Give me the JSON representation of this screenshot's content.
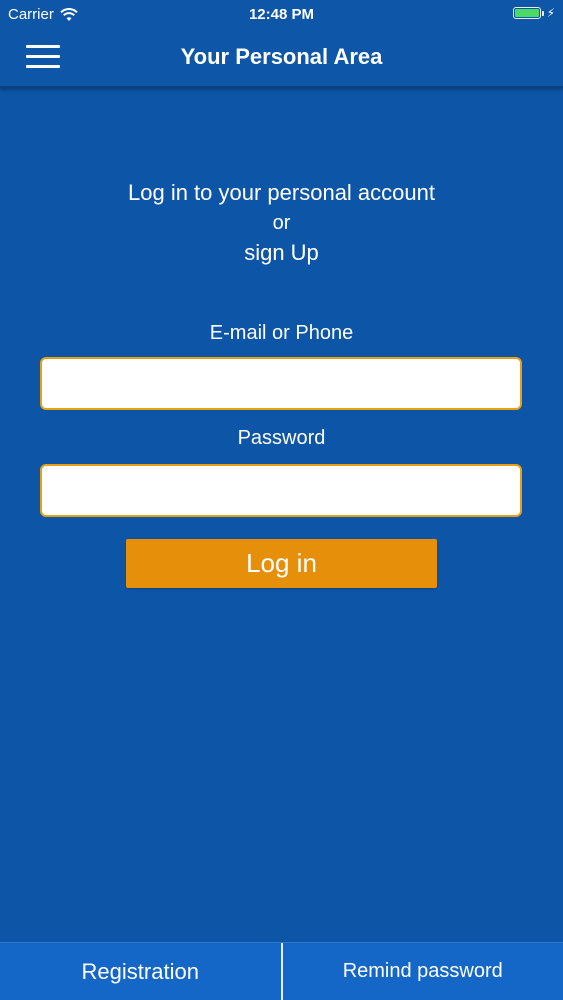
{
  "status_bar": {
    "carrier": "Carrier",
    "time": "12:48 PM",
    "battery_level": 1.0,
    "icons": [
      "wifi-icon",
      "battery-icon",
      "charging-bolt-icon"
    ]
  },
  "header": {
    "title": "Your Personal Area",
    "menu_icon": "hamburger-menu-icon"
  },
  "intro": {
    "line1": "Log in to your personal account",
    "line2": "or",
    "line3": "sign Up"
  },
  "form": {
    "email_label": "E-mail or Phone",
    "email_value": "",
    "email_placeholder": "",
    "password_label": "Password",
    "password_value": "",
    "password_placeholder": "",
    "login_label": "Log in"
  },
  "bottom_bar": {
    "registration_label": "Registration",
    "remind_label": "Remind password"
  },
  "colors": {
    "background": "#0d55a7",
    "nav": "#0e57a8",
    "accent": "#e58f0a",
    "input_border": "#e6a011",
    "bottom_bar": "#1467c7"
  }
}
